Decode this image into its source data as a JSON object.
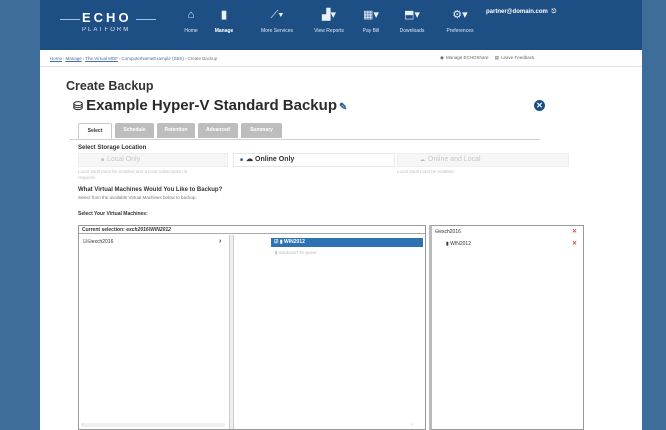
{
  "app": {
    "logo_text": "ECHO",
    "logo_sub": "PLATFORM"
  },
  "nav": [
    {
      "icon": "⌂",
      "icon_name": "home-icon",
      "label": "Home"
    },
    {
      "icon": "▮",
      "icon_name": "manage-icon",
      "label": "Manage",
      "active": true
    },
    {
      "icon": "📶",
      "icon_name": "more-services-icon",
      "label": "More Services"
    },
    {
      "icon": "📊",
      "icon_name": "reports-icon",
      "label": "View Reports"
    },
    {
      "icon": "▦",
      "icon_name": "pay-bill-icon",
      "label": "Pay Bill"
    },
    {
      "icon": "⬒",
      "icon_name": "downloads-icon",
      "label": "Downloads"
    },
    {
      "icon": "⚙",
      "icon_name": "preferences-icon",
      "label": "Preferences"
    }
  ],
  "account": {
    "email": "partner@domain.com",
    "logout_icon": "⎋"
  },
  "breadcrumb": {
    "items": [
      "Home",
      "Manage",
      "The Virtual MDF",
      "ComputerNameExample (SBS)",
      "Create Backup"
    ],
    "actions": [
      "Manage ECHOShare",
      "Leave Feedback"
    ]
  },
  "page": {
    "title": "Create Backup",
    "backup_name": "Example Hyper-V Standard Backup",
    "close_label": "✕"
  },
  "tabs": [
    {
      "label": "Select",
      "active": true
    },
    {
      "label": "Schedule"
    },
    {
      "label": "Retention"
    },
    {
      "label": "Advanced"
    },
    {
      "label": "Summary"
    }
  ],
  "storage": {
    "heading": "Select Storage Location",
    "options": [
      {
        "label": "Local Only",
        "hint": "Local Vault must be enabled and a local subscription is required.",
        "selected": false
      },
      {
        "label": "Online Only",
        "hint": "",
        "selected": true
      },
      {
        "label": "Online and Local",
        "hint": "Local Vault must be enabled.",
        "selected": false
      }
    ]
  },
  "vm_section": {
    "question": "What Virtual Machines Would You Like to Backup?",
    "question_hint": "Select from the available Virtual Machines below to backup.",
    "select_label": "Select Your Virtual Machines:",
    "current_selection_label": "Current selection:",
    "current_selection_value": "exch2016\\WIN2012"
  },
  "tree": {
    "hosts": [
      {
        "label": "exch2016",
        "checked": true
      }
    ],
    "vms": [
      {
        "label": "WIN2012",
        "selected": true
      },
      {
        "label": "windows7-hr-guest",
        "selected": false
      }
    ]
  },
  "selected_list": [
    {
      "label": "exch2016",
      "type": "host"
    },
    {
      "label": "WIN2012",
      "type": "vm"
    }
  ]
}
